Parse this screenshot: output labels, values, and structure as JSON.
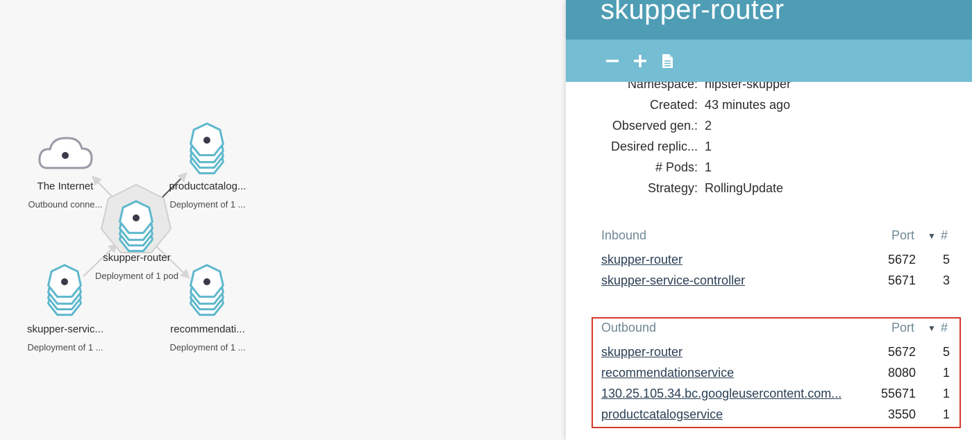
{
  "graph": {
    "nodes": [
      {
        "id": "internet",
        "label": "The Internet",
        "sub": "Outbound conne...",
        "icon": "cloud-icon"
      },
      {
        "id": "productcatalog",
        "label": "productcatalog...",
        "sub": "Deployment of 1 ...",
        "icon": "deployment-stack-icon"
      },
      {
        "id": "router",
        "label": "skupper-router",
        "sub": "Deployment of 1 pod",
        "icon": "deployment-stack-icon"
      },
      {
        "id": "service",
        "label": "skupper-servic...",
        "sub": "Deployment of 1 ...",
        "icon": "deployment-stack-icon"
      },
      {
        "id": "recommendation",
        "label": "recommendati...",
        "sub": "Deployment of 1 ...",
        "icon": "deployment-stack-icon"
      }
    ]
  },
  "panel": {
    "title": "skupper-router",
    "toolbar": {
      "icons": [
        "minus-icon",
        "plus-icon",
        "document-icon"
      ]
    },
    "properties": [
      {
        "key": "Namespace:",
        "value": "hipster-skupper"
      },
      {
        "key": "Created:",
        "value": "43 minutes ago"
      },
      {
        "key": "Observed gen.:",
        "value": "2"
      },
      {
        "key": "Desired replic...",
        "value": "1"
      },
      {
        "key": "# Pods:",
        "value": "1"
      },
      {
        "key": "Strategy:",
        "value": "RollingUpdate"
      }
    ],
    "inbound": {
      "title": "Inbound",
      "port_header": "Port",
      "count_header": "#",
      "rows": [
        {
          "name": "skupper-router",
          "port": "5672",
          "count": "5"
        },
        {
          "name": "skupper-service-controller",
          "port": "5671",
          "count": "3"
        }
      ]
    },
    "outbound": {
      "title": "Outbound",
      "port_header": "Port",
      "count_header": "#",
      "rows": [
        {
          "name": "skupper-router",
          "port": "5672",
          "count": "5"
        },
        {
          "name": "recommendationservice",
          "port": "8080",
          "count": "1"
        },
        {
          "name": "130.25.105.34.bc.googleusercontent.com...",
          "port": "55671",
          "count": "1"
        },
        {
          "name": "productcatalogservice",
          "port": "3550",
          "count": "1"
        }
      ]
    }
  },
  "colors": {
    "header": "#4e9db5",
    "toolbar": "#75bdd3",
    "node_stroke": "#5fb8cc",
    "highlight_box": "#d63a2a"
  }
}
